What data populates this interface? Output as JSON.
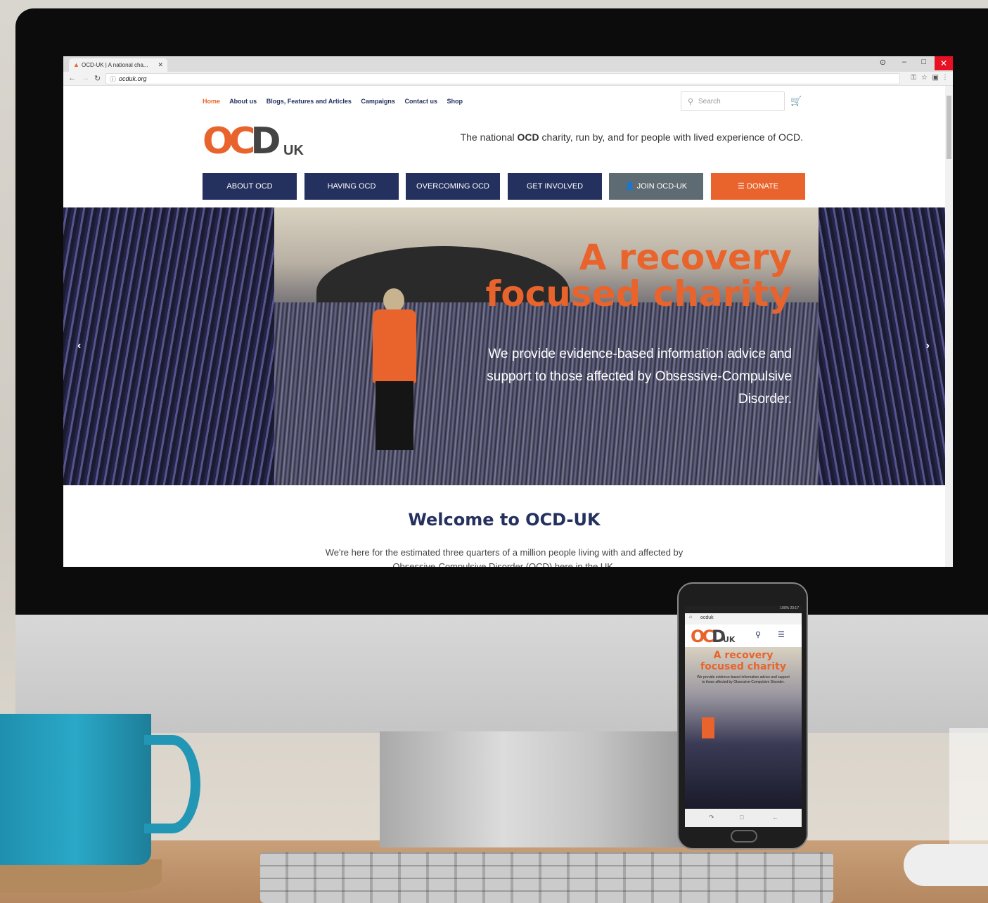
{
  "browser": {
    "tab_title": "OCD-UK | A national cha...",
    "url": "ocduk.org",
    "win_controls": {
      "account": "⊙",
      "minimize": "–",
      "restore": "□",
      "close": "✕"
    }
  },
  "site": {
    "top_nav": [
      "Home",
      "About us",
      "Blogs, Features and Articles",
      "Campaigns",
      "Contact us",
      "Shop"
    ],
    "search_placeholder": "Search",
    "logo": {
      "ocd": "OC",
      "d": "D",
      "uk": "UK"
    },
    "tagline_pre": "The national ",
    "tagline_bold": "OCD",
    "tagline_post": " charity, run by, and for people with lived experience of OCD.",
    "buttons": {
      "about": "ABOUT OCD",
      "having": "HAVING OCD",
      "overcoming": "OVERCOMING OCD",
      "involved": "GET INVOLVED",
      "join": "JOIN OCD-UK",
      "donate": "DONATE"
    },
    "hero": {
      "title_line1": "A recovery",
      "title_line2": "focused charity",
      "text": "We provide evidence-based information advice and support to those affected by Obsessive-Compulsive Disorder."
    },
    "welcome_title": "Welcome to OCD-UK",
    "intro_line1": "We're here for the estimated three quarters of a million people living with and affected by",
    "intro_line2": "Obsessive-Compulsive Disorder (OCD) here in the UK."
  },
  "phone": {
    "status": "100% 23:17",
    "url": "ocduk",
    "title_line1": "A recovery",
    "title_line2": "focused charity",
    "text": "We provide evidence-based information advice and support to those affected by Obsessive-Compulsive Disorder."
  },
  "colors": {
    "brand_orange": "#e8642c",
    "brand_navy": "#24305e",
    "join_grey": "#5f6b72"
  },
  "icons": [
    "search-icon",
    "cart-icon",
    "user-icon",
    "menu-icon",
    "chevron-left-icon",
    "chevron-right-icon",
    "back-icon",
    "forward-icon",
    "reload-icon",
    "info-icon",
    "star-icon",
    "key-icon"
  ]
}
